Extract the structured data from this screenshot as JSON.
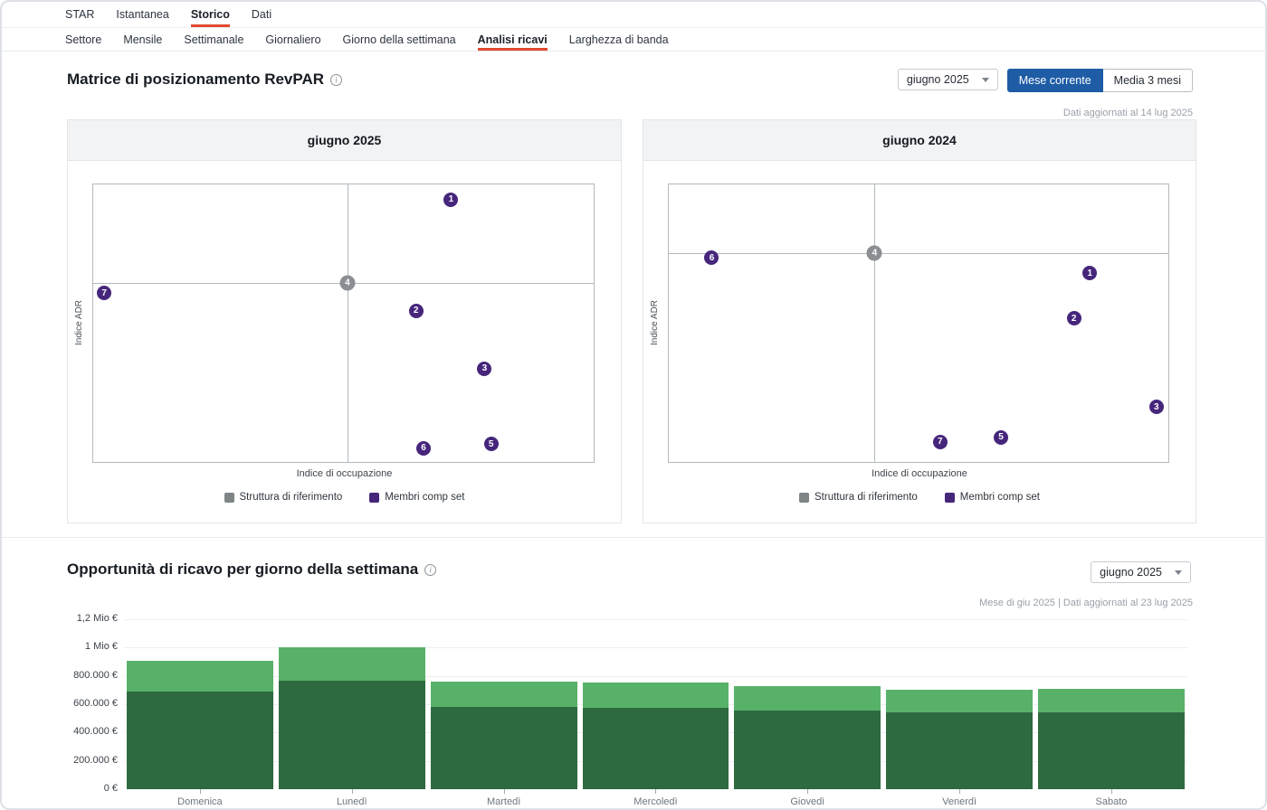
{
  "nav": {
    "primary": [
      {
        "label": "STAR",
        "active": false
      },
      {
        "label": "Istantanea",
        "active": false
      },
      {
        "label": "Storico",
        "active": true
      },
      {
        "label": "Dati",
        "active": false
      }
    ],
    "secondary": [
      {
        "label": "Settore",
        "active": false
      },
      {
        "label": "Mensile",
        "active": false
      },
      {
        "label": "Settimanale",
        "active": false
      },
      {
        "label": "Giornaliero",
        "active": false
      },
      {
        "label": "Giorno della settimana",
        "active": false
      },
      {
        "label": "Analisi ricavi",
        "active": true
      },
      {
        "label": "Larghezza di banda",
        "active": false
      }
    ]
  },
  "revpar": {
    "title": "Matrice di posizionamento RevPAR",
    "month": "giugno 2025",
    "toggle_current": "Mese corrente",
    "toggle_avg": "Media 3 mesi",
    "updated": "Dati aggiornati al 14 lug 2025"
  },
  "opportunity": {
    "title": "Opportunità di ricavo per giorno della settimana",
    "month": "giugno 2025",
    "note": "Mese di giu 2025 | Dati aggiornati al 23 lug 2025"
  },
  "colors": {
    "accent_red": "#e2492f",
    "accent_blue": "#1e5ca6",
    "comp_purple": "#46267b",
    "ref_gray": "#8b8e92",
    "bar_dark_green": "#2e6a40",
    "bar_light_green": "#58b168"
  },
  "chart_data": [
    {
      "type": "scatter",
      "title": "giugno 2025",
      "xlabel": "Indice di occupazione",
      "ylabel": "Indice ADR",
      "legend": [
        {
          "label": "Struttura di riferimento",
          "type": "ref"
        },
        {
          "label": "Membri comp set",
          "type": "comp"
        }
      ],
      "reference": {
        "x_pct": 50.8,
        "y_pct": 35.5
      },
      "points": [
        {
          "label": "1",
          "type": "comp",
          "x_pct": 71.5,
          "y_pct": 5.5
        },
        {
          "label": "2",
          "type": "comp",
          "x_pct": 64.5,
          "y_pct": 45.5
        },
        {
          "label": "3",
          "type": "comp",
          "x_pct": 78.2,
          "y_pct": 66.3
        },
        {
          "label": "4",
          "type": "ref",
          "x_pct": 50.8,
          "y_pct": 35.5
        },
        {
          "label": "5",
          "type": "comp",
          "x_pct": 79.5,
          "y_pct": 93.5
        },
        {
          "label": "6",
          "type": "comp",
          "x_pct": 66.0,
          "y_pct": 95.0
        },
        {
          "label": "7",
          "type": "comp",
          "x_pct": 2.2,
          "y_pct": 39.2
        }
      ]
    },
    {
      "type": "scatter",
      "title": "giugno 2024",
      "xlabel": "Indice di occupazione",
      "ylabel": "Indice ADR",
      "legend": [
        {
          "label": "Struttura di riferimento",
          "type": "ref"
        },
        {
          "label": "Membri comp set",
          "type": "comp"
        }
      ],
      "reference": {
        "x_pct": 41.2,
        "y_pct": 24.8
      },
      "points": [
        {
          "label": "1",
          "type": "comp",
          "x_pct": 84.3,
          "y_pct": 32.0
        },
        {
          "label": "2",
          "type": "comp",
          "x_pct": 81.1,
          "y_pct": 48.3
        },
        {
          "label": "3",
          "type": "comp",
          "x_pct": 97.6,
          "y_pct": 80.2
        },
        {
          "label": "4",
          "type": "ref",
          "x_pct": 41.2,
          "y_pct": 24.8
        },
        {
          "label": "5",
          "type": "comp",
          "x_pct": 66.5,
          "y_pct": 91.1
        },
        {
          "label": "6",
          "type": "comp",
          "x_pct": 8.6,
          "y_pct": 26.5
        },
        {
          "label": "7",
          "type": "comp",
          "x_pct": 54.3,
          "y_pct": 92.7
        }
      ]
    },
    {
      "type": "bar",
      "title": "Opportunità di ricavo per giorno della settimana",
      "categories": [
        "Domenica",
        "Lunedì",
        "Martedì",
        "Mercoledì",
        "Giovedì",
        "Venerdì",
        "Sabato"
      ],
      "series": [
        {
          "name": "ricavo-realizzato",
          "color": "#2e6a40",
          "values": [
            690000,
            765000,
            580000,
            575000,
            555000,
            545000,
            545000
          ]
        },
        {
          "name": "opportunità-di-ricavo",
          "color": "#58b168",
          "values": [
            215000,
            235000,
            180000,
            180000,
            175000,
            160000,
            165000
          ]
        }
      ],
      "ytick_values": [
        0,
        200000,
        400000,
        600000,
        800000,
        1000000,
        1200000
      ],
      "ytick_labels": [
        "0 €",
        "200.000 €",
        "400.000 €",
        "600.000 €",
        "800.000 €",
        "1 Mio €",
        "1,2 Mio €"
      ],
      "ylim": [
        0,
        1200000
      ],
      "grid": true,
      "legend_position": "none"
    }
  ]
}
